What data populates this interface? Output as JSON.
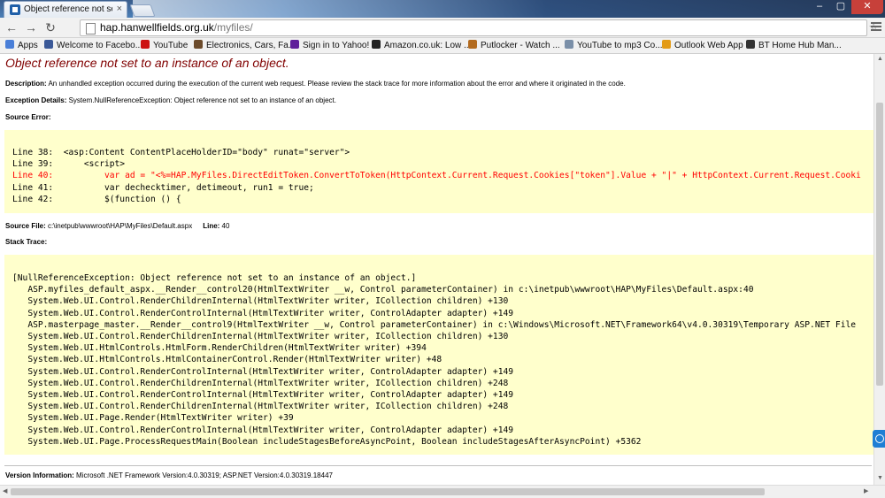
{
  "browser": {
    "tab_title": "Object reference not set to an instance of an object.",
    "tab_close": "×",
    "win_min": "–",
    "win_max": "▢",
    "win_close": "✕",
    "back_icon": "←",
    "forward_icon": "→",
    "reload_icon": "↻",
    "url_host": "hap.hanwellfields.org.uk",
    "url_path": "/myfiles/",
    "star_icon": "☆"
  },
  "bookmarks": [
    {
      "label": "Apps",
      "icon_color": "#4a7fd8"
    },
    {
      "label": "Welcome to Facebo...",
      "icon_color": "#3b5998"
    },
    {
      "label": "YouTube",
      "icon_color": "#cc1111"
    },
    {
      "label": "Electronics, Cars, Fa...",
      "icon_color": "#6b4a2a"
    },
    {
      "label": "Sign in to Yahoo!",
      "icon_color": "#5f1f9a"
    },
    {
      "label": "Amazon.co.uk: Low ...",
      "icon_color": "#222222"
    },
    {
      "label": "Putlocker - Watch ...",
      "icon_color": "#b36b1f"
    },
    {
      "label": "YouTube to mp3 Co...",
      "icon_color": "#7a8fa8"
    },
    {
      "label": "Outlook Web App",
      "icon_color": "#e39b17"
    },
    {
      "label": "BT Home Hub Man...",
      "icon_color": "#333333"
    }
  ],
  "page": {
    "error_title": "Object reference not set to an instance of an object.",
    "description_label": "Description:",
    "description_text": " An unhandled exception occurred during the execution of the current web request. Please review the stack trace for more information about the error and where it originated in the code.",
    "exception_label": "Exception Details:",
    "exception_text": " System.NullReferenceException: Object reference not set to an instance of an object.",
    "source_error_label": "Source Error:",
    "source_lines": [
      {
        "text": "Line 38:  <asp:Content ContentPlaceHolderID=\"body\" runat=\"server\">",
        "highlight": false
      },
      {
        "text": "Line 39:      <script>",
        "highlight": false
      },
      {
        "text": "Line 40:          var ad = \"<%=HAP.MyFiles.DirectEditToken.ConvertToToken(HttpContext.Current.Request.Cookies[\"token\"].Value + \"|\" + HttpContext.Current.Request.Cooki",
        "highlight": true
      },
      {
        "text": "Line 41:          var dechecktimer, detimeout, run1 = true;",
        "highlight": false
      },
      {
        "text": "Line 42:          $(function () {",
        "highlight": false
      }
    ],
    "source_file_label": "Source File:",
    "source_file_value": " c:\\inetpub\\wwwroot\\HAP\\MyFiles\\Default.aspx",
    "line_label": "Line:",
    "line_value": " 40",
    "stack_trace_label": "Stack Trace:",
    "stack_lines": [
      "[NullReferenceException: Object reference not set to an instance of an object.]",
      "   ASP.myfiles_default_aspx.__Render__control20(HtmlTextWriter __w, Control parameterContainer) in c:\\inetpub\\wwwroot\\HAP\\MyFiles\\Default.aspx:40",
      "   System.Web.UI.Control.RenderChildrenInternal(HtmlTextWriter writer, ICollection children) +130",
      "   System.Web.UI.Control.RenderControlInternal(HtmlTextWriter writer, ControlAdapter adapter) +149",
      "   ASP.masterpage_master.__Render__control9(HtmlTextWriter __w, Control parameterContainer) in c:\\Windows\\Microsoft.NET\\Framework64\\v4.0.30319\\Temporary ASP.NET File",
      "   System.Web.UI.Control.RenderChildrenInternal(HtmlTextWriter writer, ICollection children) +130",
      "   System.Web.UI.HtmlControls.HtmlForm.RenderChildren(HtmlTextWriter writer) +394",
      "   System.Web.UI.HtmlControls.HtmlContainerControl.Render(HtmlTextWriter writer) +48",
      "   System.Web.UI.Control.RenderControlInternal(HtmlTextWriter writer, ControlAdapter adapter) +149",
      "   System.Web.UI.Control.RenderChildrenInternal(HtmlTextWriter writer, ICollection children) +248",
      "   System.Web.UI.Control.RenderControlInternal(HtmlTextWriter writer, ControlAdapter adapter) +149",
      "   System.Web.UI.Control.RenderChildrenInternal(HtmlTextWriter writer, ICollection children) +248",
      "   System.Web.UI.Page.Render(HtmlTextWriter writer) +39",
      "   System.Web.UI.Control.RenderControlInternal(HtmlTextWriter writer, ControlAdapter adapter) +149",
      "   System.Web.UI.Page.ProcessRequestMain(Boolean includeStagesBeforeAsyncPoint, Boolean includeStagesAfterAsyncPoint) +5362"
    ],
    "version_label": "Version Information:",
    "version_text": " Microsoft .NET Framework Version:4.0.30319; ASP.NET Version:4.0.30319.18447"
  },
  "colors": {
    "error_title": "#800000",
    "code_background": "#ffffcc",
    "highlight_line": "#ff0000"
  }
}
